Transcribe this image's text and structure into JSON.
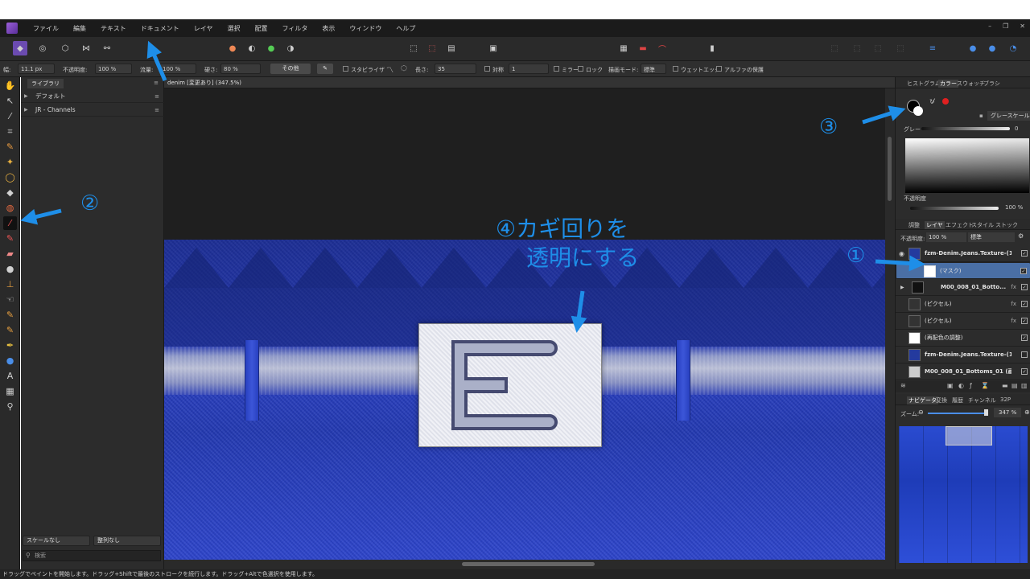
{
  "menu": [
    "ファイル",
    "編集",
    "テキスト",
    "ドキュメント",
    "レイヤ",
    "選択",
    "配置",
    "フィルタ",
    "表示",
    "ウィンドウ",
    "ヘルプ"
  ],
  "context_toolbar": {
    "width_label": "幅:",
    "width_value": "11.1 px",
    "opacity_label": "不透明度:",
    "opacity_value": "100 %",
    "flow_label": "流量:",
    "flow_value": "100 %",
    "hardness_label": "硬さ:",
    "hardness_value": "80 %",
    "more_label": "その他",
    "stabilizer_label": "スタビライザ",
    "length_label": "長さ:",
    "length_value": "35",
    "symmetry_label": "対称",
    "symmetry_value": "1",
    "mirror_label": "ミラー",
    "lock_label": "ロック",
    "blend_label": "描画モード:",
    "blend_value": "標準",
    "wet_label": "ウェットエッジ",
    "alpha_label": "アルファの保護"
  },
  "library": {
    "tab": "ライブラリ",
    "items": [
      "デフォルト",
      "JR - Channels"
    ],
    "scale_select": "スケールなし",
    "sort_select": "整列なし",
    "search_placeholder": "検索"
  },
  "document": {
    "tab_title": "denim [変更あり] (347.5%)"
  },
  "color_panel": {
    "tabs": [
      "ヒストグラム",
      "カラー",
      "スウォッチ",
      "ブラシ"
    ],
    "active_tab": "カラー",
    "mode": "グレースケール",
    "gray_label": "グレー",
    "gray_value": "0",
    "opacity_label": "不透明度",
    "opacity_value": "100 %"
  },
  "layers_panel": {
    "tabs": [
      "調整",
      "レイヤ",
      "エフェクト",
      "スタイル",
      "ストック"
    ],
    "active_tab": "レイヤ",
    "opacity_label": "不透明度:",
    "opacity_value": "100 %",
    "blend_value": "標準",
    "layers": [
      {
        "name": "fzm-Denim.Jeans.Texture-(1)...",
        "checked": true
      },
      {
        "name": "(マスク)",
        "checked": true
      },
      {
        "name": "M00_008_01_Botto...",
        "checked": true,
        "fx": "fx"
      },
      {
        "name": "(ピクセル)",
        "checked": true,
        "fx": "fx"
      },
      {
        "name": "(ピクセル)",
        "checked": true,
        "fx": "fx"
      },
      {
        "name": "(再配色の調整)",
        "checked": true
      },
      {
        "name": "fzm-Denim.Jeans.Texture-(1)...",
        "checked": false
      },
      {
        "name": "M00_008_01_Bottoms_01 (画...",
        "checked": true
      }
    ]
  },
  "navigator": {
    "tabs": [
      "ナビゲータ",
      "変換",
      "履歴",
      "チャンネル",
      "32P"
    ],
    "active_tab": "ナビゲータ",
    "zoom_label": "ズーム:",
    "zoom_value": "347 %"
  },
  "status_bar": "ドラッグでペイントを開始します。ドラッグ+Shiftで最後のストロークを続行します。ドラッグ+Altで色選択を使用します。",
  "annotations": {
    "n1": "①",
    "n2": "②",
    "n3": "③",
    "n4_line1": "④カギ回りを",
    "n4_line2": "透明にする"
  },
  "colors": {
    "annotation_blue": "#1e8ee8",
    "selected_layer": "#4a6fa5",
    "denim_blue": "#2a3fc4"
  }
}
